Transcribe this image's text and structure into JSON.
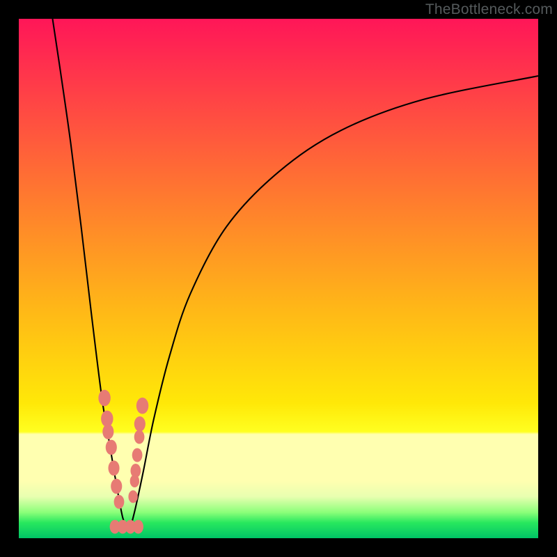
{
  "watermark": "TheBottleneck.com",
  "colors": {
    "top": "#ff1658",
    "mid": "#ffe808",
    "bottom": "#00c466",
    "marker": "#e77b74",
    "curve": "#000000"
  },
  "chart_data": {
    "type": "line",
    "title": "",
    "xlabel": "",
    "ylabel": "",
    "xlim": [
      0,
      100
    ],
    "ylim": [
      0,
      100
    ],
    "note": "No numeric axis labels are visible; values below are read off the pixel grid, normalised to a 0–100 domain on each axis. Two black curves form a sharp V whose trough sits near x≈20, y≈2. Salmon-pink markers cluster along both branches near the trough.",
    "series": [
      {
        "name": "left-branch",
        "x": [
          6.5,
          8,
          10,
          12,
          14,
          16,
          17.5,
          18.5,
          19.3,
          20,
          20.7
        ],
        "y": [
          100,
          90,
          76,
          60,
          43,
          27,
          18,
          12,
          7.5,
          4,
          2
        ]
      },
      {
        "name": "right-branch",
        "x": [
          21.5,
          22.5,
          24,
          26,
          29,
          33,
          40,
          50,
          62,
          78,
          100
        ],
        "y": [
          2,
          6,
          13,
          23,
          35,
          47,
          60,
          70.5,
          78.5,
          84.5,
          89
        ]
      }
    ],
    "markers": {
      "name": "cluster-points",
      "comment": "salmon rounded dots near trough, along both curve branches and along the floor",
      "points": [
        {
          "x": 16.5,
          "y": 27,
          "r": 1.3
        },
        {
          "x": 17.0,
          "y": 23,
          "r": 1.3
        },
        {
          "x": 17.2,
          "y": 20.5,
          "r": 1.2
        },
        {
          "x": 17.8,
          "y": 17.5,
          "r": 1.2
        },
        {
          "x": 18.3,
          "y": 13.5,
          "r": 1.2
        },
        {
          "x": 18.8,
          "y": 10,
          "r": 1.2
        },
        {
          "x": 19.3,
          "y": 7,
          "r": 1.1
        },
        {
          "x": 23.8,
          "y": 25.5,
          "r": 1.3
        },
        {
          "x": 23.3,
          "y": 22,
          "r": 1.2
        },
        {
          "x": 23.2,
          "y": 19.5,
          "r": 1.1
        },
        {
          "x": 22.8,
          "y": 16,
          "r": 1.1
        },
        {
          "x": 22.5,
          "y": 13,
          "r": 1.1
        },
        {
          "x": 22.3,
          "y": 11,
          "r": 1.0
        },
        {
          "x": 22.0,
          "y": 8,
          "r": 1.0
        },
        {
          "x": 18.5,
          "y": 2.2,
          "r": 1.1
        },
        {
          "x": 20.0,
          "y": 2.2,
          "r": 1.1
        },
        {
          "x": 21.5,
          "y": 2.2,
          "r": 1.1
        },
        {
          "x": 23.0,
          "y": 2.2,
          "r": 1.1
        }
      ]
    }
  }
}
